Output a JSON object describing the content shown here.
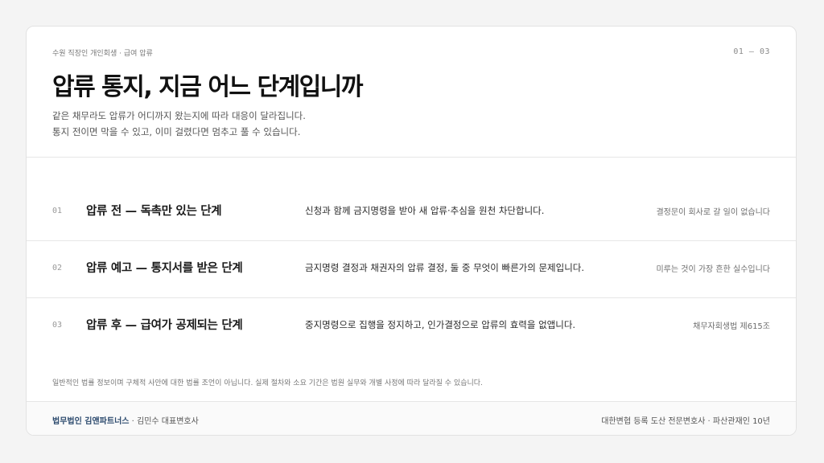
{
  "header": {
    "eyebrow": "수원 직장인 개인회생 · 급여 압류",
    "pager": "01 — 03",
    "title": "압류 통지, 지금 어느 단계입니까",
    "subtitle_line1": "같은 채무라도 압류가 어디까지 왔는지에 따라 대응이 달라집니다.",
    "subtitle_line2": "통지 전이면 막을 수 있고, 이미 걸렸다면 멈추고 풀 수 있습니다."
  },
  "stages": [
    {
      "number": "01",
      "title": "압류 전 — 독촉만 있는 단계",
      "description": "신청과 함께 금지명령을 받아 새 압류·추심을 원천 차단합니다.",
      "note": "결정문이 회사로 갈 일이 없습니다"
    },
    {
      "number": "02",
      "title": "압류 예고 — 통지서를 받은 단계",
      "description": "금지명령 결정과 채권자의 압류 결정, 둘 중 무엇이 빠른가의 문제입니다.",
      "note": "미루는 것이 가장 흔한 실수입니다"
    },
    {
      "number": "03",
      "title": "압류 후 — 급여가 공제되는 단계",
      "description": "중지명령으로 집행을 정지하고, 인가결정으로 압류의 효력을 없앱니다.",
      "note": "채무자회생법 제615조"
    }
  ],
  "disclaimer": "일반적인 법률 정보이며 구체적 사안에 대한 법률 조언이 아닙니다. 실제 절차와 소요 기간은 법원 실무와 개별 사정에 따라 달라질 수 있습니다.",
  "footer": {
    "firm_name": "법무법인 김앤파트너스",
    "firm_person": " · 김민수 대표변호사",
    "credentials": "대한변협 등록 도산 전문변호사 · 파산관재인 10년"
  },
  "colors": {
    "accent": "#2c4a6e",
    "background": "#f4f4f4",
    "card": "#ffffff"
  }
}
